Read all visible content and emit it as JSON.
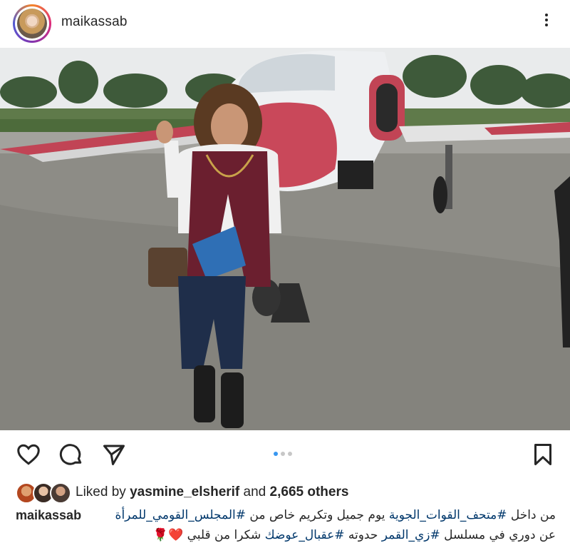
{
  "header": {
    "username": "maikassab",
    "more_icon": "more-vertical-icon"
  },
  "post": {
    "carousel": {
      "count": 3,
      "active_index": 0
    }
  },
  "actions": {
    "like_icon": "heart-icon",
    "comment_icon": "comment-icon",
    "share_icon": "send-icon",
    "save_icon": "bookmark-icon"
  },
  "likes": {
    "prefix": "Liked by",
    "user": "yasmine_elsherif",
    "middle": "and",
    "count": "2,665 others"
  },
  "caption": {
    "username": "maikassab",
    "line1_prefix": "من داخل",
    "tag1": "#متحف_القوات_الجوية",
    "line1_mid": "يوم جميل وتكريم خاص من",
    "tag2": "#المجلس_القومي_للمرأة",
    "line2_prefix": "عن دوري في مسلسل",
    "tag3": "#زي_القمر",
    "line2_mid": "حدوته",
    "tag4": "#عقبال_عوضك",
    "line2_suffix": "شكرا من قلبي",
    "emoji": "❤️🌹"
  },
  "colors": {
    "link": "#00376b",
    "carousel_active": "#3897f0",
    "carousel_inactive": "#c7c7c7",
    "text": "#262626"
  }
}
